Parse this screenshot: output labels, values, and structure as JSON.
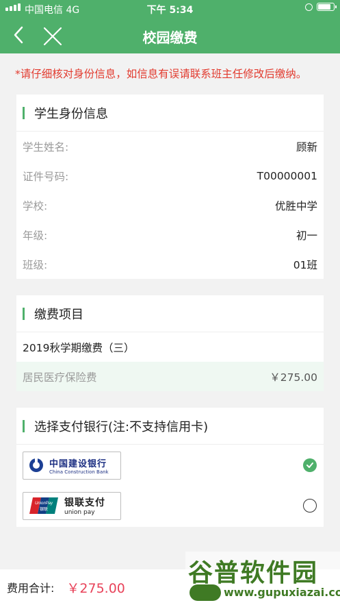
{
  "status_bar": {
    "carrier": "中国电信  4G",
    "time": "下午 5:34"
  },
  "nav": {
    "title": "校园缴费"
  },
  "notice": "*请仔细核对身份信息，如信息有误请联系班主任修改后缴纳。",
  "student_info": {
    "title": "学生身份信息",
    "rows": [
      {
        "label": "学生姓名:",
        "value": "顾新"
      },
      {
        "label": "证件号码:",
        "value": "T00000001"
      },
      {
        "label": "学校:",
        "value": "优胜中学"
      },
      {
        "label": "年级:",
        "value": "初一"
      },
      {
        "label": "班级:",
        "value": "01班"
      }
    ]
  },
  "fee_items": {
    "title": "缴费项目",
    "term": "2019秋学期缴费（三）",
    "items": [
      {
        "label": "居民医疗保险费",
        "amount": "￥275.00"
      }
    ]
  },
  "bank_select": {
    "title": "选择支付银行(注:不支持信用卡)",
    "banks": [
      {
        "name_cn": "中国建设银行",
        "name_en": "China Construction Bank",
        "selected": true
      },
      {
        "name_cn": "银联支付",
        "name_en": "union pay",
        "badge": "UnionPay 银联",
        "selected": false
      }
    ]
  },
  "footer": {
    "total_label": "费用合计:",
    "total_value": "￥275.00"
  },
  "watermark": {
    "title": "谷普软件园",
    "url": "www.gupuxiazai.com"
  },
  "colors": {
    "brand_green": "#4fb06b",
    "notice_red": "#e23b2f",
    "total_pink": "#e8435a"
  }
}
